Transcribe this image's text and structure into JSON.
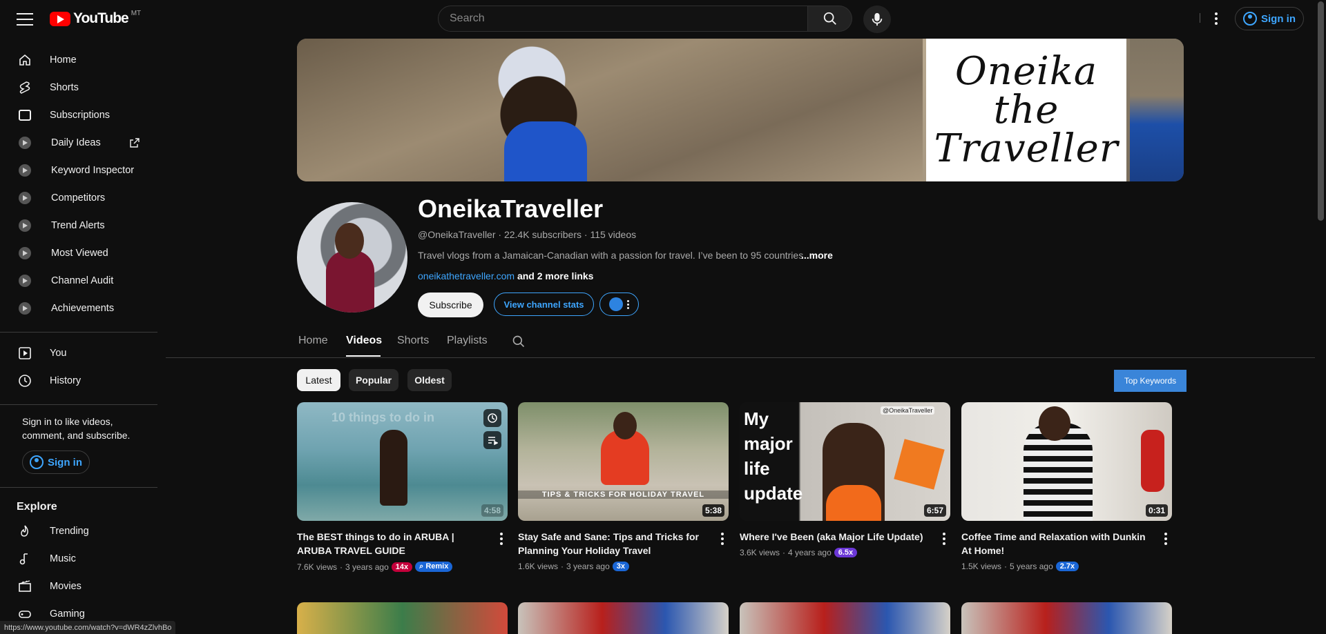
{
  "header": {
    "logo_text": "YouTube",
    "country_code": "MT",
    "search_placeholder": "Search",
    "sign_in_label": "Sign in"
  },
  "sidebar": {
    "items": [
      {
        "label": "Home",
        "icon": "home-icon"
      },
      {
        "label": "Shorts",
        "icon": "shorts-icon"
      },
      {
        "label": "Subscriptions",
        "icon": "subscriptions-icon"
      },
      {
        "label": "Daily Ideas",
        "icon": "extension-icon"
      },
      {
        "label": "Keyword Inspector",
        "icon": "extension-icon"
      },
      {
        "label": "Competitors",
        "icon": "extension-icon"
      },
      {
        "label": "Trend Alerts",
        "icon": "extension-icon"
      },
      {
        "label": "Most Viewed",
        "icon": "extension-icon"
      },
      {
        "label": "Channel Audit",
        "icon": "extension-icon"
      },
      {
        "label": "Achievements",
        "icon": "extension-icon"
      }
    ],
    "you_label": "You",
    "history_label": "History",
    "signin_prompt": "Sign in to like videos, comment, and subscribe.",
    "sign_in_label": "Sign in",
    "explore_heading": "Explore",
    "explore_items": [
      {
        "label": "Trending",
        "icon": "trending-icon"
      },
      {
        "label": "Music",
        "icon": "music-icon"
      },
      {
        "label": "Movies",
        "icon": "movies-icon"
      },
      {
        "label": "Gaming",
        "icon": "gaming-icon"
      }
    ]
  },
  "banner": {
    "card_lines": [
      "Oneika",
      "the",
      "Traveller"
    ]
  },
  "channel": {
    "name": "OneikaTraveller",
    "meta": "@OneikaTraveller · 22.4K subscribers · 115 videos",
    "description": "Travel vlogs from a Jamaican-Canadian with a passion for travel. I’ve been to 95 countries",
    "more": "...more",
    "link_url": "oneikathetraveller.com",
    "link_more": "and 2 more links",
    "subscribe_label": "Subscribe",
    "stats_label": "View channel stats"
  },
  "tabs": [
    "Home",
    "Videos",
    "Shorts",
    "Playlists"
  ],
  "active_tab": "Videos",
  "chips": [
    "Latest",
    "Popular",
    "Oldest"
  ],
  "top_keywords_label": "Top Keywords",
  "videos": [
    {
      "title": "The BEST things to do in ARUBA | ARUBA TRAVEL GUIDE",
      "views": "7.6K views",
      "age": "3 years ago",
      "badge": "14x",
      "extra_badge": "Remix",
      "duration": "4:58",
      "thumb_text": "10 things to do in"
    },
    {
      "title": "Stay Safe and Sane: Tips and Tricks for Planning Your Holiday Travel",
      "views": "1.6K views",
      "age": "3 years ago",
      "badge": "3x",
      "duration": "5:38",
      "thumb_text": "TIPS & TRICKS FOR HOLIDAY TRAVEL"
    },
    {
      "title": "Where I've Been (aka Major Life Update)",
      "views": "3.6K views",
      "age": "4 years ago",
      "badge": "6.5x",
      "duration": "6:57",
      "thumb_text": "My major life update",
      "thumb_handle": "@OneikaTraveller"
    },
    {
      "title": "Coffee Time and Relaxation with Dunkin At Home!",
      "views": "1.5K views",
      "age": "5 years ago",
      "badge": "2.7x",
      "duration": "0:31"
    }
  ],
  "status_url": "https://www.youtube.com/watch?v=dWR4zZlvhBo",
  "colors": {
    "accent": "#3ea6ff",
    "brand_red": "#ff0000",
    "background": "#0f0f0f"
  }
}
